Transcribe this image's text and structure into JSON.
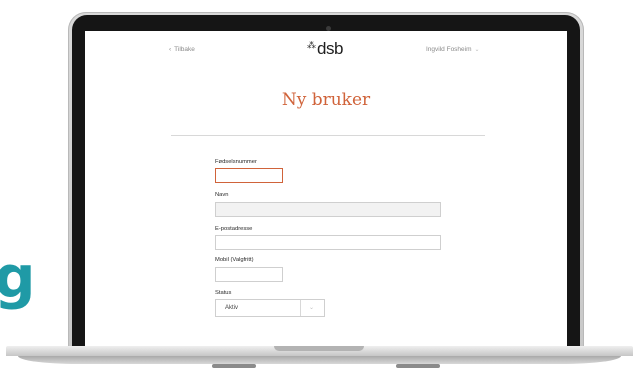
{
  "background": {
    "logo_fragment": "g",
    "accent_color": "#1f9aa6"
  },
  "header": {
    "back_label": "Tilbake",
    "back_icon": "chevron-left-icon",
    "logo_text": "dsb",
    "logo_mark": "dsb-asterisk-mark",
    "user_name": "Ingvild Fosheim",
    "user_menu_icon": "chevron-down-icon"
  },
  "page": {
    "title": "Ny bruker",
    "title_color": "#d0633a"
  },
  "form": {
    "fields": [
      {
        "label": "Fødselsnummer",
        "value": "",
        "state": "focused"
      },
      {
        "label": "Navn",
        "value": "",
        "state": "disabled"
      },
      {
        "label": "E-postadresse",
        "value": "",
        "state": "normal"
      },
      {
        "label": "Mobil (Valgfritt)",
        "value": "",
        "state": "normal"
      }
    ],
    "status": {
      "label": "Status",
      "selected": "Aktiv"
    }
  }
}
